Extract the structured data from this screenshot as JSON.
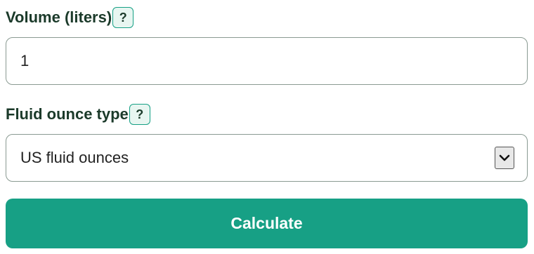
{
  "form": {
    "volume": {
      "label": "Volume (liters)",
      "help": "?",
      "value": "1"
    },
    "ounce_type": {
      "label": "Fluid ounce type",
      "help": "?",
      "selected": "US fluid ounces"
    },
    "calculate_label": "Calculate"
  },
  "colors": {
    "accent": "#17a085",
    "label_text": "#1b3a2a"
  }
}
